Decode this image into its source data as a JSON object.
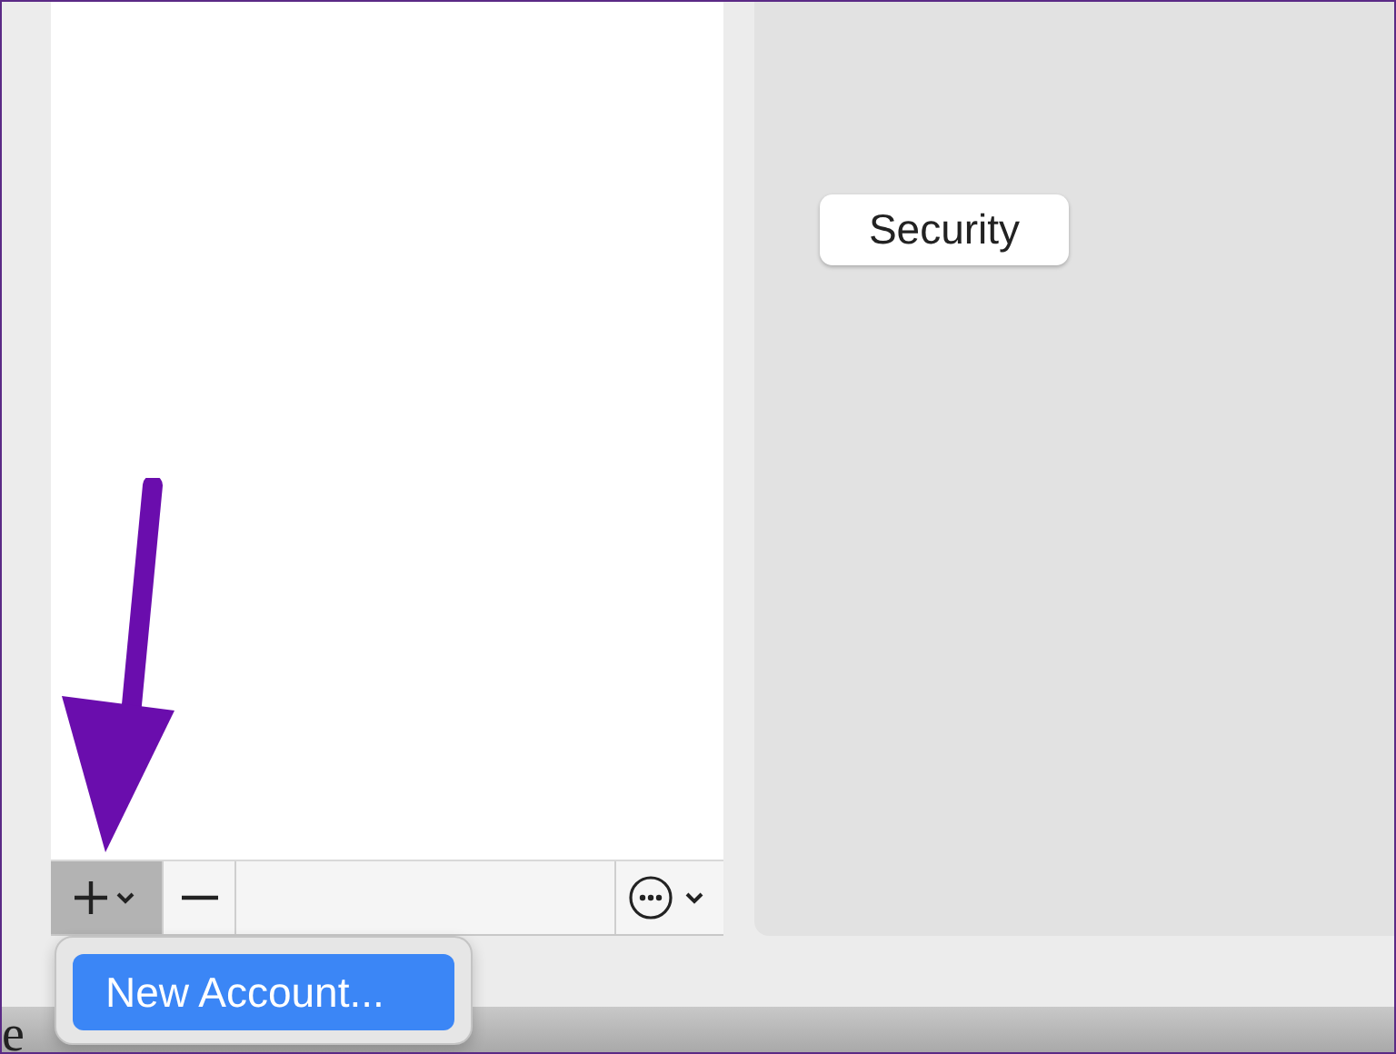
{
  "list_toolbar": [
    {
      "kind": "add",
      "pressed": true
    },
    {
      "kind": "remove",
      "pressed": false
    },
    {
      "kind": "more",
      "pressed": false
    }
  ],
  "detail_panel": {
    "button": "Security"
  },
  "add_menu": {
    "items": [
      {
        "label": "New Account...",
        "selected": true
      }
    ]
  },
  "page_text": "e"
}
